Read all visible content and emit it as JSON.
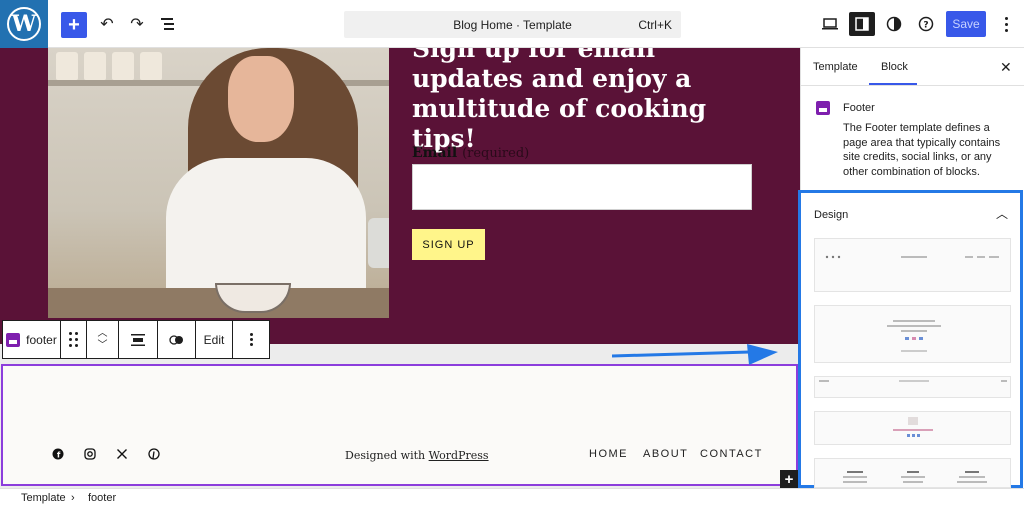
{
  "topbar": {
    "command_title": "Blog Home · Template",
    "shortcut": "Ctrl+K",
    "save_label": "Save",
    "accent": "#3858e9"
  },
  "canvas": {
    "headline": "Sign up for email updates and enjoy a multitude of cooking tips!",
    "email_label": "Email",
    "email_required": "(required)",
    "signup_label": "SIGN UP",
    "hero_color": "#5a1237"
  },
  "block_toolbar": {
    "block_name": "footer",
    "edit_label": "Edit"
  },
  "footer": {
    "credit_prefix": "Designed with ",
    "credit_link": "WordPress",
    "nav": [
      "HOME",
      "ABOUT",
      "CONTACT"
    ],
    "social_icons": [
      "facebook-icon",
      "instagram-icon",
      "x-icon",
      "pinterest-icon"
    ]
  },
  "sidebar": {
    "tabs": [
      "Template",
      "Block"
    ],
    "active_tab": "Block",
    "block_title": "Footer",
    "block_description": "The Footer template defines a page area that typically contains site credits, social links, or any other combination of blocks.",
    "design_label": "Design",
    "highlight_color": "#2479e6"
  },
  "breadcrumb": {
    "items": [
      "Template",
      "footer"
    ]
  }
}
